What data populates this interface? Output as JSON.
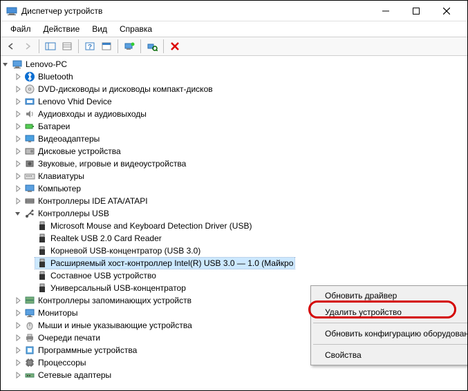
{
  "window": {
    "title": "Диспетчер устройств"
  },
  "menu": {
    "file": "Файл",
    "action": "Действие",
    "view": "Вид",
    "help": "Справка"
  },
  "tree": {
    "root": "Lenovo-PC",
    "items": [
      "Bluetooth",
      "DVD-дисководы и дисководы компакт-дисков",
      "Lenovo Vhid Device",
      "Аудиовходы и аудиовыходы",
      "Батареи",
      "Видеоадаптеры",
      "Дисковые устройства",
      "Звуковые, игровые и видеоустройства",
      "Клавиатуры",
      "Компьютер",
      "Контроллеры IDE ATA/ATAPI",
      "Контроллеры USB",
      "Контроллеры запоминающих устройств",
      "Мониторы",
      "Мыши и иные указывающие устройства",
      "Очереди печати",
      "Программные устройства",
      "Процессоры",
      "Сетевые адаптеры"
    ],
    "usb_children": [
      "Microsoft Mouse and Keyboard Detection Driver (USB)",
      "Realtek USB 2.0 Card Reader",
      "Корневой USB-концентратор (USB 3.0)",
      "Расширяемый хост-контроллер Intel(R) USB 3.0 — 1.0 (Майкро",
      "Составное USB устройство",
      "Универсальный USB-концентратор"
    ]
  },
  "context_menu": {
    "update_driver": "Обновить драйвер",
    "uninstall_device": "Удалить устройство",
    "scan_hardware": "Обновить конфигурацию оборудовани",
    "properties": "Свойства"
  }
}
